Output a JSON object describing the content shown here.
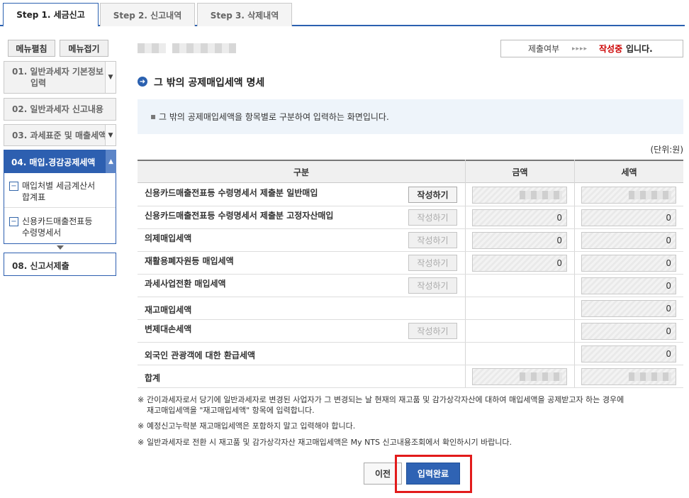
{
  "tabs": [
    {
      "label": "Step 1. 세금신고"
    },
    {
      "label": "Step 2. 신고내역"
    },
    {
      "label": "Step 3. 삭제내역"
    }
  ],
  "sidebar": {
    "expand_label": "메뉴펼침",
    "collapse_label": "메뉴접기",
    "items": [
      {
        "label": "01. 일반과세자 기본정보",
        "label2": "입력"
      },
      {
        "label": "02. 일반과세자 신고내용"
      },
      {
        "label": "03. 과세표준 및 매출세액"
      },
      {
        "label": "04. 매입.경감공제세액"
      },
      {
        "label": "08. 신고서제출"
      }
    ],
    "subitems": [
      {
        "line1": "매입처별 세금계산서",
        "line2": "합계표"
      },
      {
        "line1": "신용카드매출전표등",
        "line2": "수령명세서"
      }
    ]
  },
  "status": {
    "key": "제출여부",
    "arrows": "▸▸▸▸",
    "value_red": "작성중",
    "value_suffix": "입니다."
  },
  "section": {
    "title": "그 밖의 공제매입세액 명세",
    "info": "그 밖의 공제매입세액을 항목별로 구분하여 입력하는 화면입니다.",
    "unit": "(단위:원)"
  },
  "table": {
    "headers": [
      "구분",
      "금액",
      "세액"
    ],
    "write_label": "작성하기",
    "rows": [
      {
        "label": "신용카드매출전표등 수령명세서 제출분 일반매입",
        "amount": "",
        "tax": ""
      },
      {
        "label": "신용카드매출전표등 수령명세서 제출분 고정자산매입",
        "amount": "0",
        "tax": "0"
      },
      {
        "label": "의제매입세액",
        "amount": "0",
        "tax": "0"
      },
      {
        "label": "재활용폐자원등 매입세액",
        "amount": "0",
        "tax": "0"
      },
      {
        "label": "과세사업전환 매입세액",
        "tax": "0"
      },
      {
        "label": "재고매입세액",
        "tax": "0"
      },
      {
        "label": "변제대손세액",
        "tax": "0"
      },
      {
        "label": "외국인 관광객에 대한 환급세액",
        "tax": "0"
      },
      {
        "label": "합계",
        "amount": "",
        "tax": ""
      }
    ]
  },
  "notes": [
    {
      "mark": "※",
      "line1": "간이과세자로서 당기에 일반과세자로 변경된 사업자가 그 변경되는 날 현재의 재고품 및 감가상각자산에 대하여 매입세액을 공제받고자 하는 경우에",
      "line2": "재고매입세액을 \"재고매입세액\" 항목에 입력합니다."
    },
    {
      "mark": "※",
      "line1": "예정신고누락분 재고매입세액은 포함하지 말고 입력해야 합니다."
    },
    {
      "mark": "※",
      "line1": "일반과세자로 전환 시 재고품 및 감가상각자산 재고매입세액은 My NTS 신고내용조회에서 확인하시기 바랍니다."
    }
  ],
  "buttons": {
    "prev": "이전",
    "done": "입력완료"
  }
}
